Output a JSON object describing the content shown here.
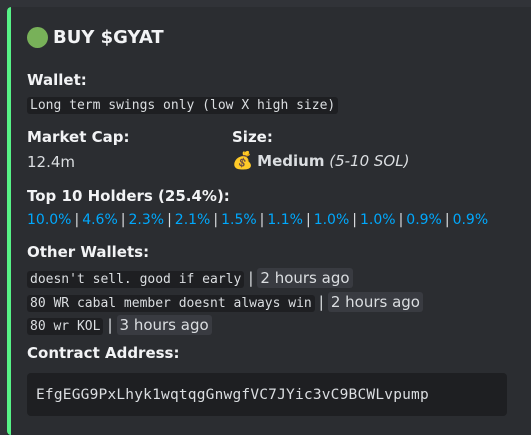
{
  "title": "BUY $GYAT",
  "wallet": {
    "label": "Wallet:",
    "value": "Long term swings only (low X high size)"
  },
  "market_cap": {
    "label": "Market Cap:",
    "value": "12.4m"
  },
  "size": {
    "label": "Size:",
    "icon": "money-bag-icon",
    "main": "Medium",
    "sub": "(5-10 SOL)"
  },
  "holders": {
    "label": "Top 10 Holders (25.4%):",
    "values": [
      "10.0%",
      "4.6%",
      "2.3%",
      "2.1%",
      "1.5%",
      "1.1%",
      "1.0%",
      "1.0%",
      "0.9%",
      "0.9%"
    ]
  },
  "other_wallets": {
    "label": "Other Wallets:",
    "items": [
      {
        "note": "doesn't sell. good if early",
        "time": "2 hours ago"
      },
      {
        "note": "80 WR cabal member doesnt always win",
        "time": "2 hours ago"
      },
      {
        "note": "80 wr KOL",
        "time": "3 hours ago"
      }
    ]
  },
  "contract": {
    "label": "Contract Address:",
    "value": "EfgEGG9PxLhyk1wqtqgGnwgfVC7JYic3vC9BCWLvpump"
  },
  "colors": {
    "accent": "#57f287",
    "link": "#00a8fc",
    "background": "#2b2d31"
  }
}
